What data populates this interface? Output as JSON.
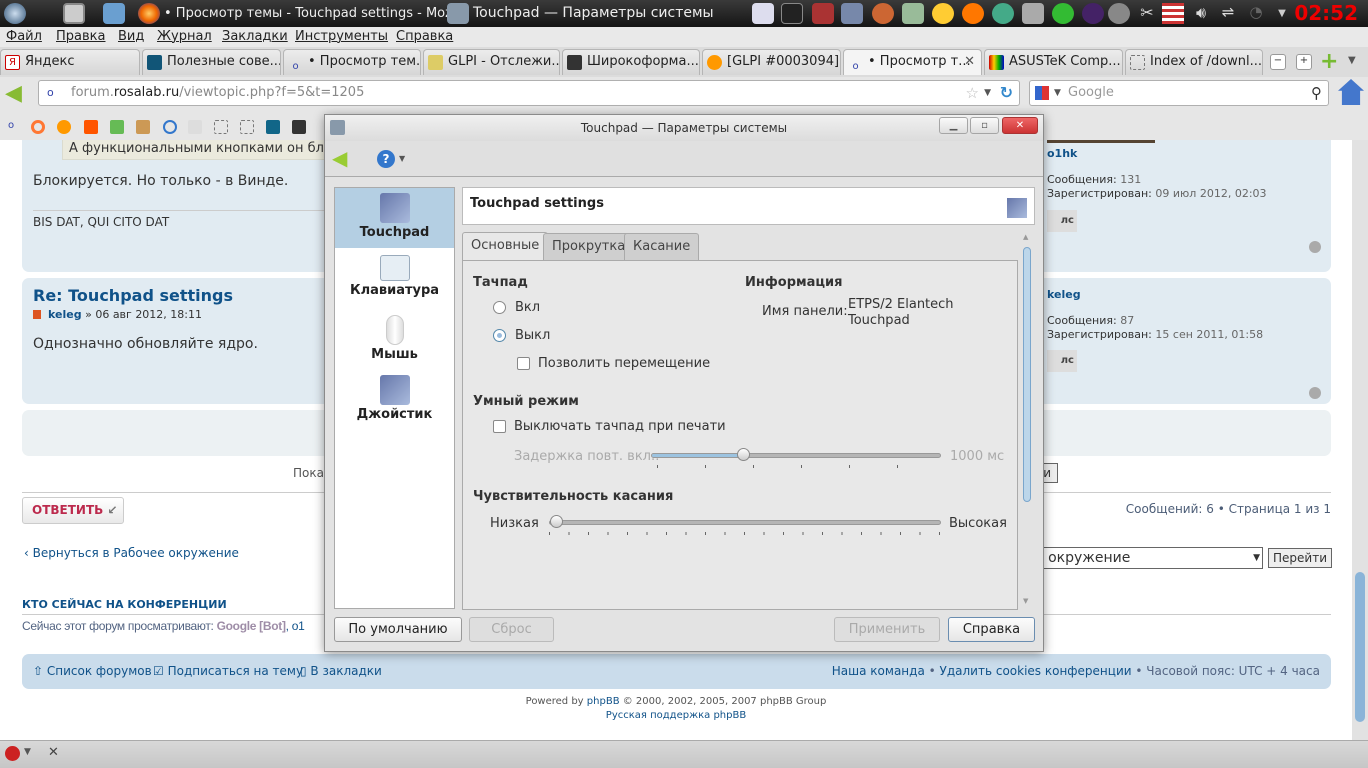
{
  "taskbar": {
    "tasks": [
      {
        "label": "• Просмотр темы - Touchpad settings - Moz"
      },
      {
        "label": "Touchpad — Параметры системы"
      }
    ],
    "clock": "02:52"
  },
  "menu": [
    "Файл",
    "Правка",
    "Вид",
    "Журнал",
    "Закладки",
    "Инструменты",
    "Справка"
  ],
  "tabs": [
    {
      "label": "Яндекс"
    },
    {
      "label": "Полезные сове..."
    },
    {
      "label": "• Просмотр тем..."
    },
    {
      "label": "GLPI - Отслежи..."
    },
    {
      "label": "Широкоформа..."
    },
    {
      "label": "[GLPI #0003094]..."
    },
    {
      "label": "• Просмотр т..."
    },
    {
      "label": "ASUSTeK Comp..."
    },
    {
      "label": "Index of /downl..."
    }
  ],
  "nav": {
    "url_domain_pre": "forum.",
    "url_domain": "rosalab.ru",
    "url_path": "/viewtopic.php?f=5&t=1205",
    "search_placeholder": "Google"
  },
  "forum": {
    "quote_text": "А функциональными кнопками он блокир",
    "post1_body": "Блокируется. Но только - в Винде.",
    "post1_sig": "BIS DAT, QUI CITO DAT",
    "post1_author": "o1hk",
    "post1_posts_label": "Сообщения:",
    "post1_posts": "131",
    "post1_reg_label": "Зарегистрирован:",
    "post1_reg": "09 июл 2012, 02:03",
    "pm_label": "лс",
    "post2_title": "Re: Touchpad settings",
    "post2_author": "keleg",
    "post2_date": "» 06 авг 2012, 18:11",
    "post2_body": "Однозначно обновляйте ядро.",
    "post2_posts": "87",
    "post2_reg": "15 сен 2011, 01:58",
    "show_label": "Показ",
    "go_btn_partial": "и",
    "reply_button": "ОТВЕТИТЬ",
    "pagination": "Сообщений: 6 • Страница 1 из 1",
    "back_link": "Вернуться в Рабочее окружение",
    "jump_select": "е окружение",
    "jump_go": "Перейти",
    "who_online_title": "КТО СЕЙЧАС НА КОНФЕРЕНЦИИ",
    "who_online_text": "Сейчас этот форум просматривают:",
    "who_online_bot": "Google [Bot]",
    "who_online_user": ", o1",
    "footer": {
      "forums_list": "Список форумов",
      "subscribe": "Подписаться на тему",
      "bookmark": "В закладки",
      "team": "Наша команда",
      "delete_cookies": "Удалить cookies конференции",
      "timezone": "Часовой пояс: UTC + 4 часа"
    },
    "powered_pre": "Powered by",
    "powered_link": "phpBB",
    "powered_post": "© 2000, 2002, 2005, 2007 phpBB Group",
    "russian_support": "Русская поддержка phpBB"
  },
  "dialog": {
    "title": "Touchpad — Параметры системы",
    "sidebar": [
      {
        "label": "Touchpad"
      },
      {
        "label": "Клавиатура"
      },
      {
        "label": "Мышь"
      },
      {
        "label": "Джойстик"
      }
    ],
    "header": "Touchpad settings",
    "tabs": [
      "Основные",
      "Прокрутка",
      "Касание"
    ],
    "touchpad_title": "Тачпад",
    "on": "Вкл",
    "off": "Выкл",
    "allow_move": "Позволить перемещение",
    "info_title": "Информация",
    "panel_name_label": "Имя панели:",
    "panel_name_1": "ETPS/2 Elantech",
    "panel_name_2": "Touchpad",
    "smart_title": "Умный режим",
    "disable_typing": "Выключать тачпад при печати",
    "delay_label": "Задержка повт. вкл.:",
    "delay_value": "1000  мс",
    "delay_fraction": 0.31,
    "sens_title": "Чувствительность касания",
    "sens_low": "Низкая",
    "sens_high": "Высокая",
    "sens_fraction": 0.0,
    "btn_defaults": "По умолчанию",
    "btn_reset": "Сброс",
    "btn_apply": "Применить",
    "btn_help": "Справка",
    "selected_radio": "off"
  }
}
